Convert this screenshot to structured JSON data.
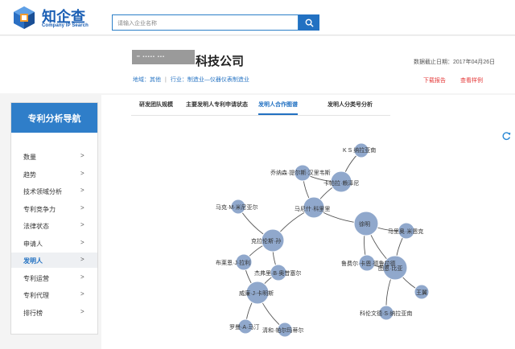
{
  "header": {
    "logo_text": "知企查",
    "logo_sub": "Company IP Search",
    "search_placeholder": "请输入企业名称"
  },
  "company": {
    "name_redacted": "━ ▪▪▪▪▪ ▪▪▪",
    "name_suffix": "科技公司",
    "region_label": "地域：其他",
    "industry_label": "行业：制造业—仪器仪表制造业",
    "deadline": "数据截止日期：2017年04月26日",
    "download_report": "下载报告",
    "view_sample": "查看样例"
  },
  "sidebar": {
    "title": "专利分析导航",
    "items": [
      {
        "label": "数量",
        "arrow": ">"
      },
      {
        "label": "趋势",
        "arrow": ">"
      },
      {
        "label": "技术领域分析",
        "arrow": ">"
      },
      {
        "label": "专利竞争力",
        "arrow": ">"
      },
      {
        "label": "法律状态",
        "arrow": ">"
      },
      {
        "label": "申请人",
        "arrow": ">"
      },
      {
        "label": "发明人",
        "arrow": ">"
      },
      {
        "label": "专利运营",
        "arrow": ">"
      },
      {
        "label": "专利代理",
        "arrow": ">"
      },
      {
        "label": "排行榜",
        "arrow": ">"
      }
    ],
    "active_index": 6
  },
  "tabs": [
    {
      "label": "研发团队规模"
    },
    {
      "label": "主要发明人专利申请状态"
    },
    {
      "label": "发明人合作图谱"
    },
    {
      "label": "发明人分类号分析"
    }
  ],
  "active_tab": 2,
  "graph": {
    "node_color": "#90a8cc",
    "edge_color": "#555555",
    "nodes": [
      {
        "id": "ks",
        "label": "K S 纳拉亚南"
      },
      {
        "id": "qiaonasen",
        "label": "乔纳森·提尔斯·汉里韦斯"
      },
      {
        "id": "kapula",
        "label": "卡帕拉·赖泽尼"
      },
      {
        "id": "maxini",
        "label": "马尼什·科里里"
      },
      {
        "id": "xuming",
        "label": "徐明"
      },
      {
        "id": "makem",
        "label": "马克·M·米尼亚尔"
      },
      {
        "id": "malixiu",
        "label": "马里奥·米恩克"
      },
      {
        "id": "kelalun",
        "label": "克拉伦斯·孙"
      },
      {
        "id": "buluoen",
        "label": "布莱恩·J·拉利"
      },
      {
        "id": "jiexiya",
        "label": "杰弗里·B·奥昔塞尔"
      },
      {
        "id": "lufeier",
        "label": "鲁费尔·卡恩·德鲁拉德"
      },
      {
        "id": "tushu",
        "label": "图恩·比亚"
      },
      {
        "id": "weilian",
        "label": "威廉·J·卡明斯"
      },
      {
        "id": "wangyi",
        "label": "王翼"
      },
      {
        "id": "luoman",
        "label": "罗曼·A·马汀"
      },
      {
        "id": "qingke",
        "label": "清和·帕尔玛蒂尔"
      },
      {
        "id": "kelunwen",
        "label": "科伦文德·S·纳拉亚南"
      }
    ],
    "edges": [
      [
        "ks",
        "kapula"
      ],
      [
        "qiaonasen",
        "kapula"
      ],
      [
        "kapula",
        "maxini"
      ],
      [
        "qiaonasen",
        "maxini"
      ],
      [
        "maxini",
        "xuming"
      ],
      [
        "maxini",
        "kelalun"
      ],
      [
        "makem",
        "kelalun"
      ],
      [
        "kelalun",
        "buluoen"
      ],
      [
        "kelalun",
        "jiexiya"
      ],
      [
        "buluoen",
        "weilian"
      ],
      [
        "jiexiya",
        "weilian"
      ],
      [
        "weilian",
        "luoman"
      ],
      [
        "weilian",
        "qingke"
      ],
      [
        "xuming",
        "malixiu"
      ],
      [
        "xuming",
        "lufeier"
      ],
      [
        "xuming",
        "tushu"
      ],
      [
        "lufeier",
        "tushu"
      ],
      [
        "tushu",
        "wangyi"
      ],
      [
        "tushu",
        "kelunwen"
      ],
      [
        "malixiu",
        "tushu"
      ]
    ]
  }
}
